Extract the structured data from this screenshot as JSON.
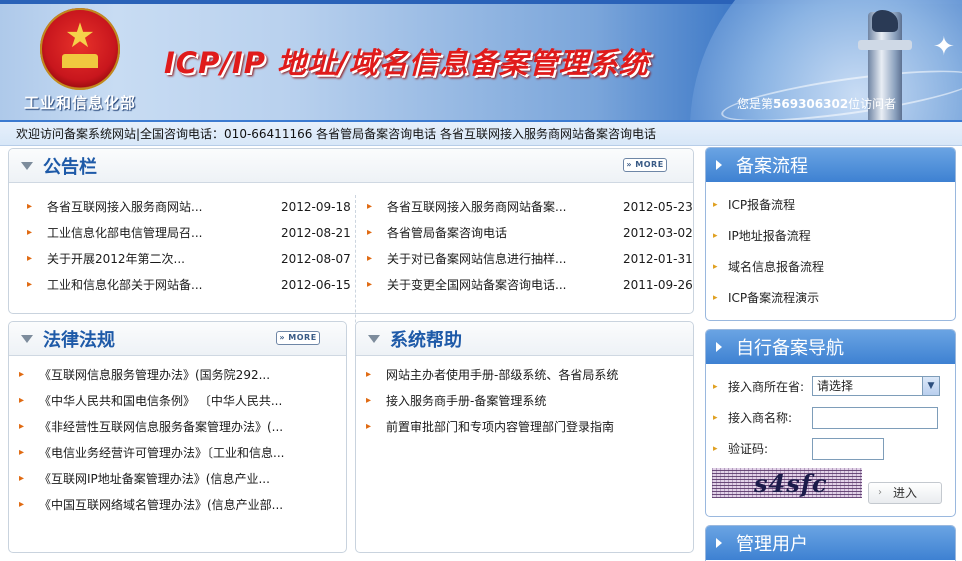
{
  "header": {
    "department": "工业和信息化部",
    "title": "ICP/IP 地址/域名信息备案管理系统",
    "visitor_prefix": "您是第",
    "visitor_count": "569306302",
    "visitor_suffix": "位访问者"
  },
  "notice": {
    "text": "欢迎访问备案系统网站|全国咨询电话：010-66411166 各省管局备案咨询电话 各省互联网接入服务商网站备案咨询电话"
  },
  "bulletin": {
    "title": "公告栏",
    "more_label": "MORE",
    "left_items": [
      {
        "text": "各省互联网接入服务商网站...",
        "date": "2012-09-18"
      },
      {
        "text": "工业信息化部电信管理局召...",
        "date": "2012-08-21"
      },
      {
        "text": "关于开展2012年第二次...",
        "date": "2012-08-07"
      },
      {
        "text": "工业和信息化部关于网站备...",
        "date": "2012-06-15"
      }
    ],
    "right_items": [
      {
        "text": "各省互联网接入服务商网站备案...",
        "date": "2012-05-23"
      },
      {
        "text": "各省管局备案咨询电话",
        "date": "2012-03-02"
      },
      {
        "text": "关于对已备案网站信息进行抽样...",
        "date": "2012-01-31"
      },
      {
        "text": "关于变更全国网站备案咨询电话...",
        "date": "2011-09-26"
      }
    ]
  },
  "laws": {
    "title": "法律法规",
    "more_label": "MORE",
    "items": [
      "《互联网信息服务管理办法》(国务院292...",
      "《中华人民共和国电信条例》 〔中华人民共...",
      "《非经营性互联网信息服务备案管理办法》(...",
      "《电信业务经营许可管理办法》〔工业和信息...",
      "《互联网IP地址备案管理办法》(信息产业...",
      "《中国互联网络域名管理办法》(信息产业部..."
    ]
  },
  "help": {
    "title": "系统帮助",
    "items": [
      "网站主办者使用手册-部级系统、各省局系统",
      "接入服务商手册-备案管理系统",
      "前置审批部门和专项内容管理部门登录指南"
    ]
  },
  "flow": {
    "title": "备案流程",
    "items": [
      "ICP报备流程",
      "IP地址报备流程",
      "域名信息报备流程",
      "ICP备案流程演示"
    ]
  },
  "self_nav": {
    "title": "自行备案导航",
    "province_label": "接入商所在省:",
    "province_value": "请选择",
    "name_label": "接入商名称:",
    "name_value": "",
    "captcha_label": "验证码:",
    "captcha_value": "",
    "captcha_image_text": "s4sfc",
    "enter_label": "进入"
  },
  "admin": {
    "title": "管理用户"
  },
  "colors": {
    "accent_blue": "#1e5aa8",
    "bullet_orange": "#e06a12",
    "title_red": "#e01b1b"
  }
}
